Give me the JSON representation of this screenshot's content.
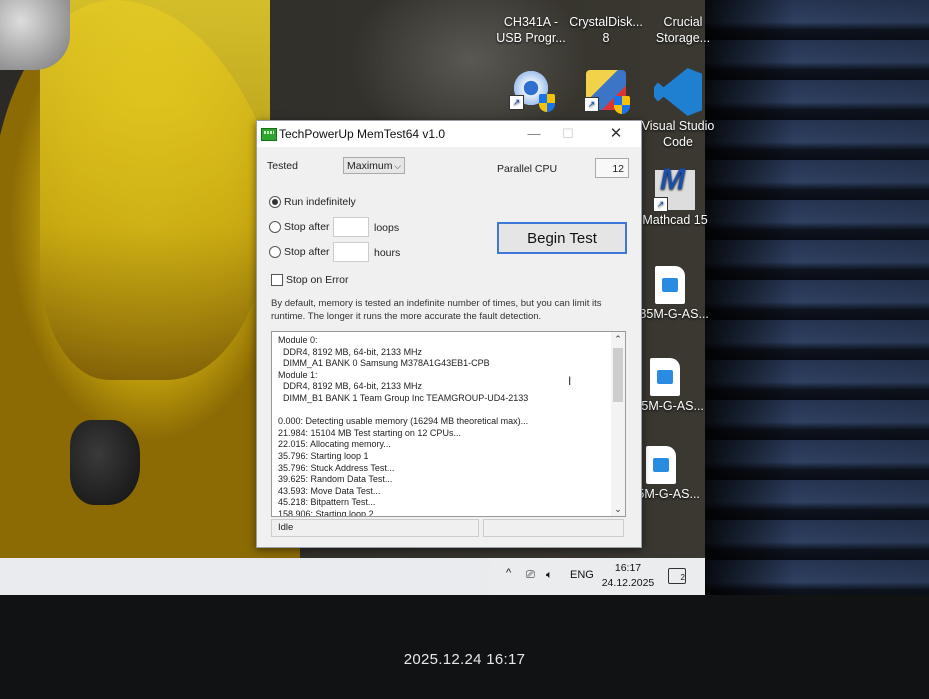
{
  "desktop_icons": [
    {
      "name": "ch341a-icon",
      "label": "CH341A -\nUSB Progr...",
      "kind": "partial"
    },
    {
      "name": "crystaldisk-icon",
      "label": "CrystalDisk...\n8",
      "kind": "partial"
    },
    {
      "name": "crucial-icon",
      "label": "Crucial\nStorage...",
      "kind": "partial"
    },
    {
      "name": "fan-utility-icon",
      "label": "",
      "kind": "fan"
    },
    {
      "name": "installer-icon",
      "label": "",
      "kind": "installer"
    },
    {
      "name": "vscode-icon",
      "label": "Visual Studio\nCode",
      "kind": "vscode"
    },
    {
      "name": "mathcad-icon",
      "label": "Mathcad 15",
      "kind": "mathcad"
    },
    {
      "name": "document-icon",
      "label": "B85M-G-AS...",
      "kind": "doc"
    },
    {
      "name": "document-icon",
      "label": "B85M-G-AS...",
      "kind": "doc"
    },
    {
      "name": "document-icon",
      "label": "B85M-G-AS...",
      "kind": "doc"
    }
  ],
  "window": {
    "title": "TechPowerUp MemTest64 v1.0",
    "min_glyph": "—",
    "max_glyph": "☐",
    "close_glyph": "✕",
    "tested_label": "Tested",
    "tested_value": "Maximum",
    "parallel_label": "Parallel CPU",
    "parallel_value": "12",
    "run_indefinitely": "Run indefinitely",
    "stop_after": "Stop after",
    "loops": "loops",
    "hours": "hours",
    "stop_on_error": "Stop on Error",
    "begin_test": "Begin Test",
    "info_text": "By default, memory is tested an indefinite number of times, but you can limit its runtime. The longer it runs the more accurate the fault detection.",
    "status": "Idle",
    "log_lines": [
      "Module 0:",
      "  DDR4, 8192 MB, 64-bit, 2133 MHz",
      "  DIMM_A1 BANK 0 Samsung M378A1G43EB1-CPB",
      "Module 1:",
      "  DDR4, 8192 MB, 64-bit, 2133 MHz",
      "  DIMM_B1 BANK 1 Team Group Inc TEAMGROUP-UD4-2133",
      "",
      "0.000: Detecting usable memory (16294 MB theoretical max)...",
      "21.984: 15104 MB Test starting on 12 CPUs...",
      "22.015: Allocating memory...",
      "35.796: Starting loop 1",
      "35.796: Stuck Address Test...",
      "39.625: Random Data Test...",
      "43.593: Move Data Test...",
      "45.218: Bitpattern Test...",
      "158.906: Starting loop 2"
    ]
  },
  "taskbar": {
    "chevron": "^",
    "language": "ENG",
    "time": "16:17",
    "date": "24.12.2025",
    "notifications": "2"
  },
  "photo_timestamp": "2025.12.24 16:17"
}
